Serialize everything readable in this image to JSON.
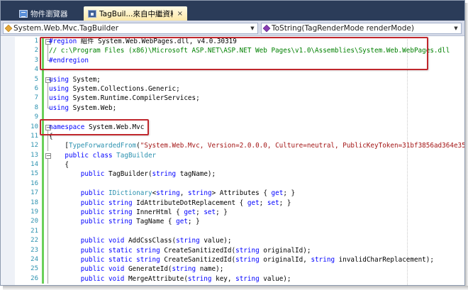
{
  "tabs": {
    "browser_label": "物件瀏覽器",
    "active_label": "TagBuil...來自中繼資料]",
    "active_close": "×",
    "active_pin": "▾"
  },
  "navbar": {
    "type_combo": "System.Web.Mvc.TagBuilder",
    "member_combo": "ToString(TagRenderMode renderMode)"
  },
  "icons": {
    "browser_tab": "object-browser-icon",
    "file_tab": "csharp-file-icon",
    "type_combo": "class-icon",
    "member_combo": "method-icon"
  },
  "annotation_color": "#c0272d",
  "editor": {
    "lines": [
      {
        "n": "1",
        "tokens": [
          {
            "t": "#region",
            "c": "kw"
          },
          {
            "t": " 組件 System.Web.WebPages.dll, v4.0.30319",
            "c": ""
          }
        ]
      },
      {
        "n": "2",
        "tokens": [
          {
            "t": "// c:\\Program Files (x86)\\Microsoft ASP.NET\\ASP.NET Web Pages\\v1.0\\Assemblies\\System.Web.WebPages.dll",
            "c": "cm"
          }
        ]
      },
      {
        "n": "3",
        "tokens": [
          {
            "t": "#endregion",
            "c": "kw"
          }
        ]
      },
      {
        "n": "4",
        "tokens": []
      },
      {
        "n": "5",
        "tokens": [
          {
            "t": "using",
            "c": "kw"
          },
          {
            "t": " System;",
            "c": ""
          }
        ]
      },
      {
        "n": "6",
        "tokens": [
          {
            "t": "using",
            "c": "kw"
          },
          {
            "t": " System.Collections.Generic;",
            "c": ""
          }
        ]
      },
      {
        "n": "7",
        "tokens": [
          {
            "t": "using",
            "c": "kw"
          },
          {
            "t": " System.Runtime.CompilerServices;",
            "c": ""
          }
        ]
      },
      {
        "n": "8",
        "tokens": [
          {
            "t": "using",
            "c": "kw"
          },
          {
            "t": " System.Web;",
            "c": ""
          }
        ]
      },
      {
        "n": "9",
        "tokens": []
      },
      {
        "n": "10",
        "tokens": [
          {
            "t": "namespace",
            "c": "kw"
          },
          {
            "t": " System.Web.Mvc",
            "c": ""
          }
        ]
      },
      {
        "n": "11",
        "tokens": [
          {
            "t": "{",
            "c": ""
          }
        ]
      },
      {
        "n": "12",
        "tokens": [
          {
            "t": "    [",
            "c": ""
          },
          {
            "t": "TypeForwardedFrom",
            "c": "at"
          },
          {
            "t": "(",
            "c": ""
          },
          {
            "t": "\"System.Web.Mvc, Version=2.0.0.0, Culture=neutral, PublicKeyToken=31bf3856ad364e35\"",
            "c": "st"
          },
          {
            "t": ")]",
            "c": ""
          }
        ]
      },
      {
        "n": "13",
        "tokens": [
          {
            "t": "    ",
            "c": ""
          },
          {
            "t": "public class",
            "c": "kw"
          },
          {
            "t": " ",
            "c": ""
          },
          {
            "t": "TagBuilder",
            "c": "ty"
          }
        ]
      },
      {
        "n": "14",
        "tokens": [
          {
            "t": "    {",
            "c": ""
          }
        ]
      },
      {
        "n": "15",
        "tokens": [
          {
            "t": "        ",
            "c": ""
          },
          {
            "t": "public",
            "c": "kw"
          },
          {
            "t": " TagBuilder(",
            "c": ""
          },
          {
            "t": "string",
            "c": "kw"
          },
          {
            "t": " tagName);",
            "c": ""
          }
        ]
      },
      {
        "n": "16",
        "tokens": []
      },
      {
        "n": "17",
        "tokens": [
          {
            "t": "        ",
            "c": ""
          },
          {
            "t": "public",
            "c": "kw"
          },
          {
            "t": " ",
            "c": ""
          },
          {
            "t": "IDictionary",
            "c": "ty"
          },
          {
            "t": "<",
            "c": ""
          },
          {
            "t": "string",
            "c": "kw"
          },
          {
            "t": ", ",
            "c": ""
          },
          {
            "t": "string",
            "c": "kw"
          },
          {
            "t": "> Attributes { ",
            "c": ""
          },
          {
            "t": "get",
            "c": "kw"
          },
          {
            "t": "; }",
            "c": ""
          }
        ]
      },
      {
        "n": "18",
        "tokens": [
          {
            "t": "        ",
            "c": ""
          },
          {
            "t": "public string",
            "c": "kw"
          },
          {
            "t": " IdAttributeDotReplacement { ",
            "c": ""
          },
          {
            "t": "get",
            "c": "kw"
          },
          {
            "t": "; ",
            "c": ""
          },
          {
            "t": "set",
            "c": "kw"
          },
          {
            "t": "; }",
            "c": ""
          }
        ]
      },
      {
        "n": "19",
        "tokens": [
          {
            "t": "        ",
            "c": ""
          },
          {
            "t": "public string",
            "c": "kw"
          },
          {
            "t": " InnerHtml { ",
            "c": ""
          },
          {
            "t": "get",
            "c": "kw"
          },
          {
            "t": "; ",
            "c": ""
          },
          {
            "t": "set",
            "c": "kw"
          },
          {
            "t": "; }",
            "c": ""
          }
        ]
      },
      {
        "n": "20",
        "tokens": [
          {
            "t": "        ",
            "c": ""
          },
          {
            "t": "public string",
            "c": "kw"
          },
          {
            "t": " TagName { ",
            "c": ""
          },
          {
            "t": "get",
            "c": "kw"
          },
          {
            "t": "; }",
            "c": ""
          }
        ]
      },
      {
        "n": "21",
        "tokens": []
      },
      {
        "n": "22",
        "tokens": [
          {
            "t": "        ",
            "c": ""
          },
          {
            "t": "public void",
            "c": "kw"
          },
          {
            "t": " AddCssClass(",
            "c": ""
          },
          {
            "t": "string",
            "c": "kw"
          },
          {
            "t": " value);",
            "c": ""
          }
        ]
      },
      {
        "n": "23",
        "tokens": [
          {
            "t": "        ",
            "c": ""
          },
          {
            "t": "public static string",
            "c": "kw"
          },
          {
            "t": " CreateSanitizedId(",
            "c": ""
          },
          {
            "t": "string",
            "c": "kw"
          },
          {
            "t": " originalId);",
            "c": ""
          }
        ]
      },
      {
        "n": "24",
        "tokens": [
          {
            "t": "        ",
            "c": ""
          },
          {
            "t": "public static string",
            "c": "kw"
          },
          {
            "t": " CreateSanitizedId(",
            "c": ""
          },
          {
            "t": "string",
            "c": "kw"
          },
          {
            "t": " originalId, ",
            "c": ""
          },
          {
            "t": "string",
            "c": "kw"
          },
          {
            "t": " invalidCharReplacement);",
            "c": ""
          }
        ]
      },
      {
        "n": "25",
        "tokens": [
          {
            "t": "        ",
            "c": ""
          },
          {
            "t": "public void",
            "c": "kw"
          },
          {
            "t": " GenerateId(",
            "c": ""
          },
          {
            "t": "string",
            "c": "kw"
          },
          {
            "t": " name);",
            "c": ""
          }
        ]
      },
      {
        "n": "26",
        "tokens": [
          {
            "t": "        ",
            "c": ""
          },
          {
            "t": "public void",
            "c": "kw"
          },
          {
            "t": " MergeAttribute(",
            "c": ""
          },
          {
            "t": "string",
            "c": "kw"
          },
          {
            "t": " key, ",
            "c": ""
          },
          {
            "t": "string",
            "c": "kw"
          },
          {
            "t": " value);",
            "c": ""
          }
        ]
      }
    ]
  }
}
